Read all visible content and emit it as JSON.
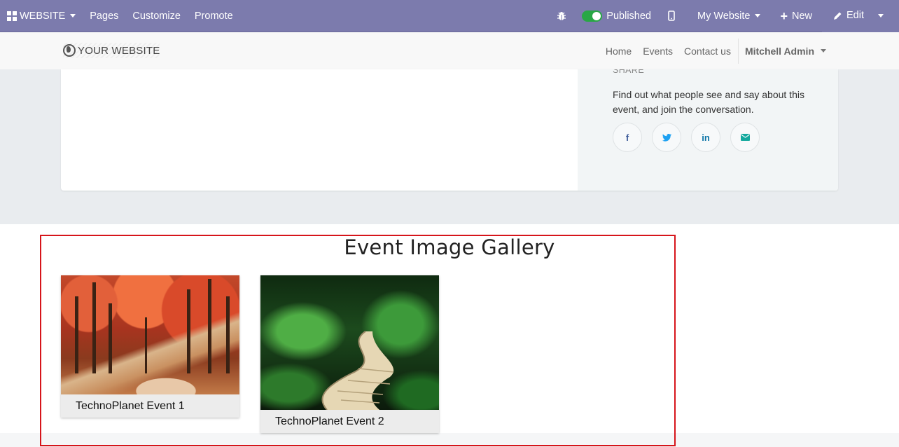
{
  "topbar": {
    "app": "WEBSITE",
    "menu": [
      "Pages",
      "Customize",
      "Promote"
    ],
    "published": "Published",
    "website": "My Website",
    "new": "New",
    "edit": "Edit"
  },
  "nav": {
    "logo": "YOUR WEBSITE",
    "links": [
      "Home",
      "Events",
      "Contact us"
    ],
    "user": "Mitchell Admin"
  },
  "share": {
    "heading": "SHARE",
    "text": "Find out what people see and say about this event, and join the conversation.",
    "buttons": [
      {
        "icon": "facebook-icon",
        "glyph": "f",
        "color": "#3b5998"
      },
      {
        "icon": "twitter-icon",
        "glyph": "t",
        "color": "#1da1f2"
      },
      {
        "icon": "linkedin-icon",
        "glyph": "in",
        "color": "#0e76a8"
      },
      {
        "icon": "email-icon",
        "glyph": "✉",
        "color": "#12a89d"
      }
    ]
  },
  "gallery": {
    "title": "Event Image Gallery",
    "items": [
      {
        "caption": "TechnoPlanet Event 1"
      },
      {
        "caption": "TechnoPlanet Event 2"
      }
    ]
  },
  "colors": {
    "admin_bar": "#7c7bad",
    "published_toggle": "#28a745",
    "highlight_border": "#d6151b"
  }
}
